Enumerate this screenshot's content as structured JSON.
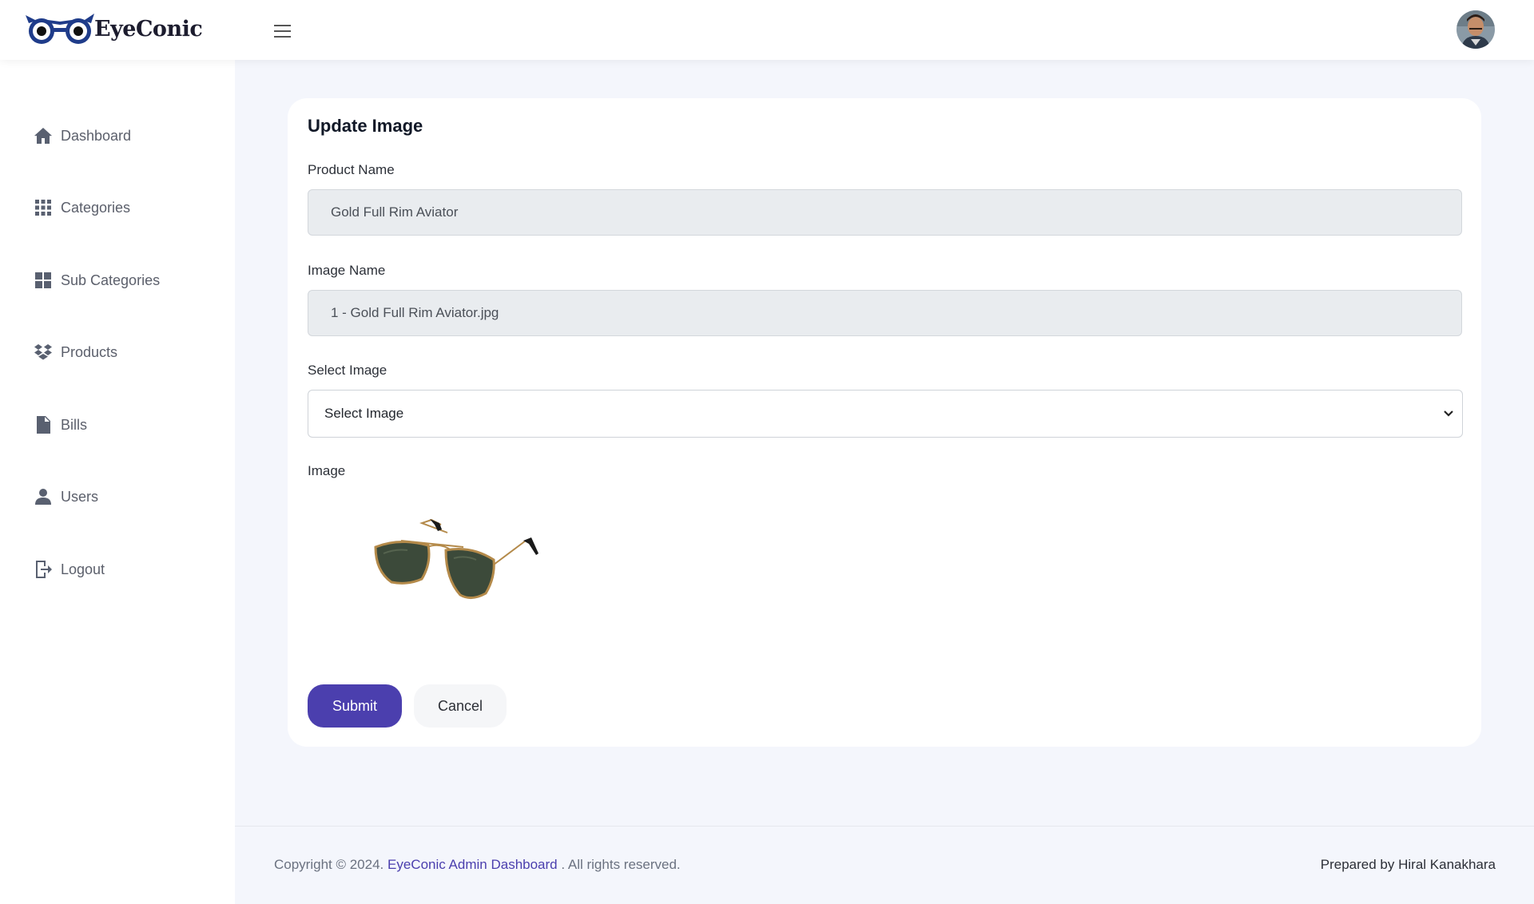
{
  "brand": {
    "name": "EyeConic"
  },
  "colors": {
    "accent": "#4b3fae",
    "sidebar_icon": "#596070",
    "page_bg": "#f4f6fc"
  },
  "sidebar": {
    "items": [
      {
        "label": "Dashboard",
        "icon": "home-icon"
      },
      {
        "label": "Categories",
        "icon": "grid-dots-icon"
      },
      {
        "label": "Sub Categories",
        "icon": "grid-squares-icon"
      },
      {
        "label": "Products",
        "icon": "boxes-icon"
      },
      {
        "label": "Bills",
        "icon": "document-icon"
      },
      {
        "label": "Users",
        "icon": "user-icon"
      },
      {
        "label": "Logout",
        "icon": "logout-icon"
      }
    ]
  },
  "form": {
    "title": "Update Image",
    "product_name_label": "Product Name",
    "product_name_value": "Gold Full Rim Aviator",
    "image_name_label": "Image Name",
    "image_name_value": "1 - Gold Full Rim Aviator.jpg",
    "select_image_label": "Select Image",
    "select_image_value": "Select Image",
    "image_label": "Image",
    "submit_label": "Submit",
    "cancel_label": "Cancel"
  },
  "footer": {
    "copyright_prefix": "Copyright © 2024.",
    "link_text": "EyeConic Admin Dashboard",
    "copyright_suffix": ". All rights reserved.",
    "prepared_by": "Prepared by Hiral Kanakhara"
  }
}
